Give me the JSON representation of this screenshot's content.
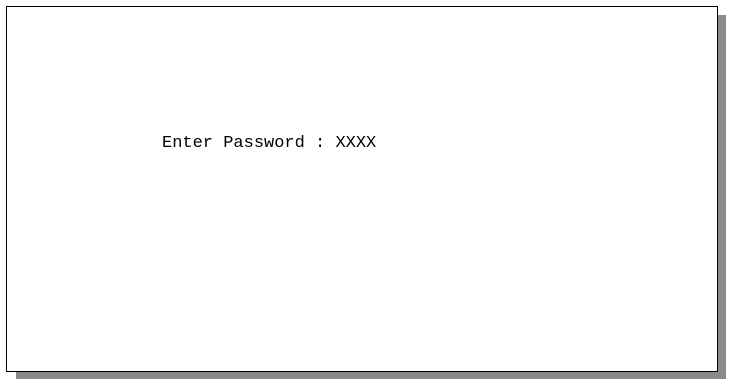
{
  "terminal": {
    "prompt_label": "Enter Password",
    "separator": " : ",
    "password_value": "XXXX"
  }
}
